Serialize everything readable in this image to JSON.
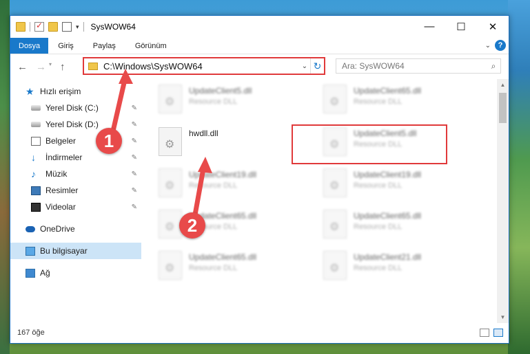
{
  "window": {
    "title": "SysWOW64",
    "buttons": {
      "minimize": "—",
      "maximize": "☐",
      "close": "✕"
    }
  },
  "ribbon": {
    "tabs": [
      {
        "label": "Dosya",
        "active": true
      },
      {
        "label": "Giriş",
        "active": false
      },
      {
        "label": "Paylaş",
        "active": false
      },
      {
        "label": "Görünüm",
        "active": false
      }
    ],
    "help_label": "?"
  },
  "address": {
    "path": "C:\\Windows\\SysWOW64",
    "search_placeholder": "Ara: SysWOW64"
  },
  "sidebar": {
    "items": [
      {
        "label": "Hızlı erişim",
        "icon": "star-icon"
      },
      {
        "label": "Yerel Disk (C:)",
        "icon": "disk-icon",
        "pinned": true
      },
      {
        "label": "Yerel Disk (D:)",
        "icon": "disk-icon",
        "pinned": true
      },
      {
        "label": "Belgeler",
        "icon": "document-icon",
        "pinned": true
      },
      {
        "label": "İndirmeler",
        "icon": "download-icon",
        "pinned": true
      },
      {
        "label": "Müzik",
        "icon": "music-icon",
        "pinned": true
      },
      {
        "label": "Resimler",
        "icon": "pictures-icon",
        "pinned": true
      },
      {
        "label": "Videolar",
        "icon": "video-icon",
        "pinned": true
      },
      {
        "label": "OneDrive",
        "icon": "onedrive-icon"
      },
      {
        "label": "Bu bilgisayar",
        "icon": "computer-icon",
        "selected": true
      },
      {
        "label": "Ağ",
        "icon": "network-icon"
      }
    ]
  },
  "files": [
    {
      "name": "UpdateClient5.dll",
      "desc": "Resource DLL"
    },
    {
      "name": "UpdateClient65.dll",
      "desc": "Resource DLL"
    },
    {
      "name": "hwdll.dll",
      "desc": ""
    },
    {
      "name": "UpdateClient5.dll",
      "desc": "Resource DLL"
    },
    {
      "name": "UpdateClient19.dll",
      "desc": "Resource DLL"
    },
    {
      "name": "UpdateClient19.dll",
      "desc": "Resource DLL"
    },
    {
      "name": "UpdateClient65.dll",
      "desc": "Resource DLL"
    },
    {
      "name": "UpdateClient65.dll",
      "desc": "Resource DLL"
    },
    {
      "name": "UpdateClient65.dll",
      "desc": "Resource DLL"
    },
    {
      "name": "UpdateClient21.dll",
      "desc": "Resource DLL"
    }
  ],
  "status": {
    "count": "167 öğe"
  },
  "annotations": {
    "marker1": "1",
    "marker2": "2"
  },
  "colors": {
    "accent": "#1979ca",
    "highlight": "#e0393a",
    "marker": "#e84a4a"
  }
}
